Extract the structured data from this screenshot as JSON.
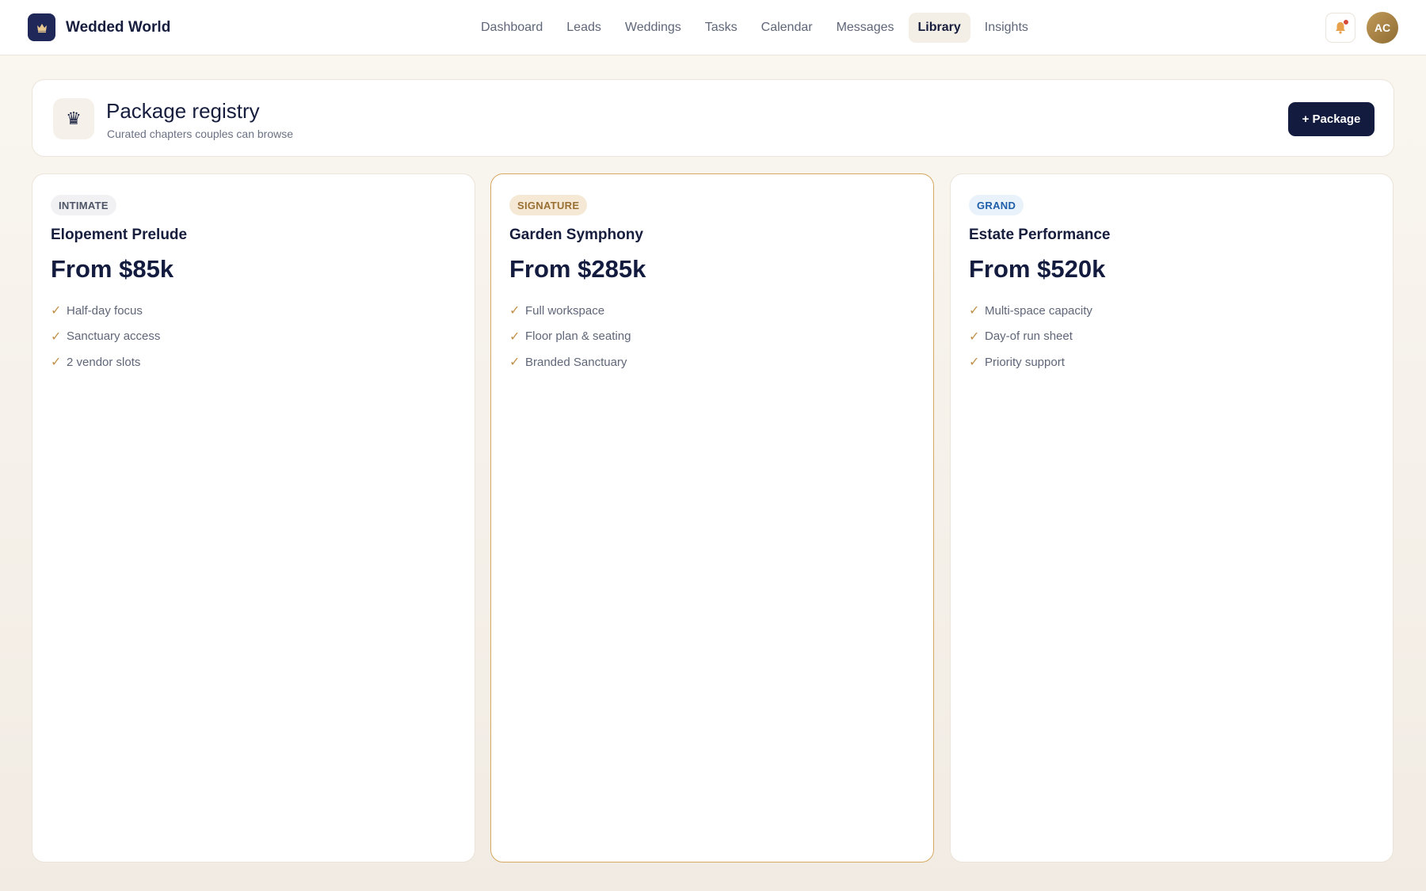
{
  "app": {
    "name": "Wedded World"
  },
  "nav": [
    {
      "label": "Dashboard",
      "active": false
    },
    {
      "label": "Leads",
      "active": false
    },
    {
      "label": "Weddings",
      "active": false
    },
    {
      "label": "Tasks",
      "active": false
    },
    {
      "label": "Calendar",
      "active": false
    },
    {
      "label": "Messages",
      "active": false
    },
    {
      "label": "Library",
      "active": true
    },
    {
      "label": "Insights",
      "active": false
    }
  ],
  "user": {
    "initials": "AC"
  },
  "header": {
    "icon": "crown-icon",
    "title": "Package registry",
    "subtitle": "Curated chapters couples can browse",
    "add_label": "+ Package"
  },
  "packages": [
    {
      "tier": "INTIMATE",
      "name": "Elopement Prelude",
      "price": "From $85k",
      "features": [
        "Half-day focus",
        "Sanctuary access",
        "2 vendor slots"
      ]
    },
    {
      "tier": "SIGNATURE",
      "name": "Garden Symphony",
      "price": "From $285k",
      "features": [
        "Full workspace",
        "Floor plan & seating",
        "Branded Sanctuary"
      ]
    },
    {
      "tier": "GRAND",
      "name": "Estate Performance",
      "price": "From $520k",
      "features": [
        "Multi-space capacity",
        "Day-of run sheet",
        "Priority support"
      ]
    }
  ],
  "colors": {
    "brand_navy": "#131b3f",
    "accent_gold": "#c2924b",
    "intimate_badge_bg": "#f1f1f3",
    "intimate_badge_fg": "#4e5566",
    "signature_badge_bg": "#f5e9d6",
    "signature_badge_fg": "#9a6f33",
    "grand_badge_bg": "#e9f2fb",
    "grand_badge_fg": "#1f5ea8",
    "notification_dot": "#d64a3a"
  }
}
